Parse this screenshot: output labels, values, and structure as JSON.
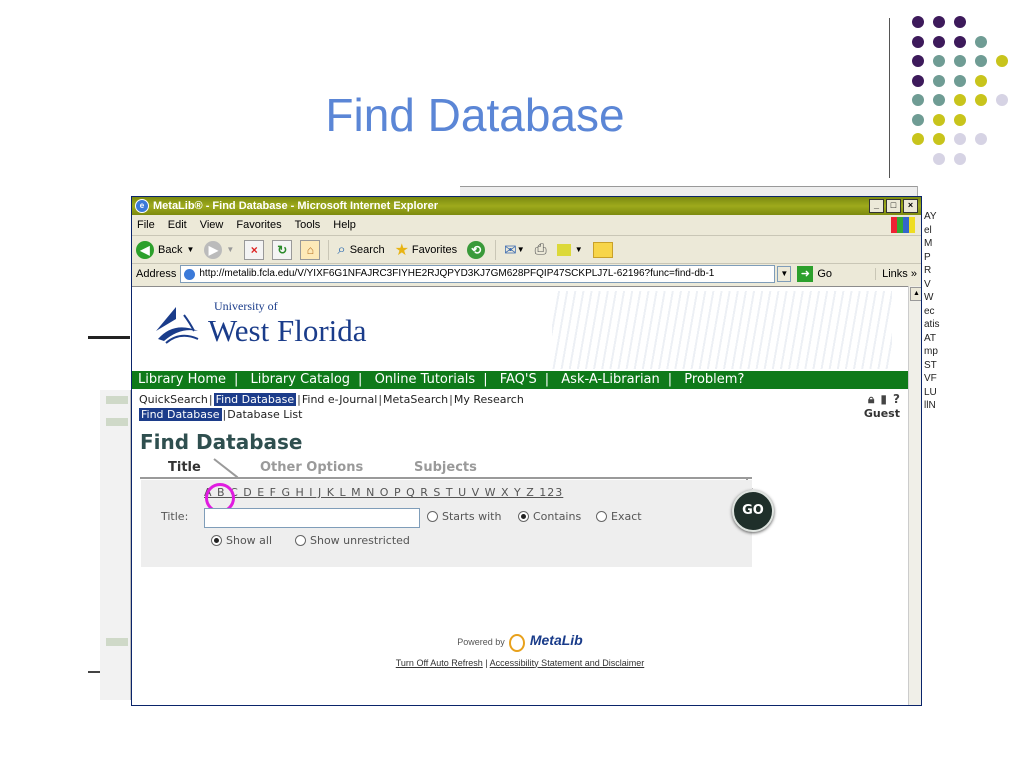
{
  "slide": {
    "title": "Find Database"
  },
  "browser": {
    "window_title": "MetaLib® - Find Database - Microsoft Internet Explorer",
    "menu": [
      "File",
      "Edit",
      "View",
      "Favorites",
      "Tools",
      "Help"
    ],
    "toolbar": {
      "back": "Back",
      "search": "Search",
      "favorites": "Favorites"
    },
    "address_label": "Address",
    "address_url": "http://metalib.fcla.edu/V/YIXF6G1NFAJRC3FIYHE2RJQPYD3KJ7GM628PFQIP47SCKPLJ7L-62196?func=find-db-1",
    "go_label": "Go",
    "links_label": "Links"
  },
  "page": {
    "university_small": "University of",
    "university_name": "West Florida",
    "nav": [
      "Library Home",
      "Library Catalog",
      "Online Tutorials",
      "FAQ'S",
      "Ask-A-Librarian",
      "Problem?"
    ],
    "subnav": [
      "QuickSearch",
      "Find Database",
      "Find e-Journal",
      "MetaSearch",
      "My Research"
    ],
    "subnav2": [
      "Find Database",
      "Database List"
    ],
    "user": "Guest",
    "heading": "Find Database",
    "tabs": [
      "Title",
      "Other Options",
      "Subjects"
    ],
    "alphabet": "A B C D E F G H I J K L M N O P Q R S T U V W X Y Z 123",
    "title_label": "Title:",
    "title_value": "",
    "match_options": [
      "Starts with",
      "Contains",
      "Exact"
    ],
    "match_selected": "Contains",
    "show_options": [
      "Show all",
      "Show unrestricted"
    ],
    "show_selected": "Show all",
    "go_button": "GO",
    "powered_by": "Powered by",
    "metalib": "MetaLib",
    "footer_links": [
      "Turn Off Auto Refresh",
      "Accessibility Statement and Disclaimer"
    ]
  },
  "background_window_text": [
    "AY",
    "el",
    "M",
    "P",
    "R",
    "V",
    "W",
    "ec",
    "atis",
    "AT",
    "mp",
    "ST",
    "VF",
    "LU",
    "llN"
  ],
  "colors": {
    "purple": "#3d1a5b",
    "teal": "#6f9c94",
    "yellow": "#c8c41c",
    "lavender": "#d6d3e4",
    "nav_green": "#0f7a1a",
    "highlight_circle": "#e01be0"
  }
}
